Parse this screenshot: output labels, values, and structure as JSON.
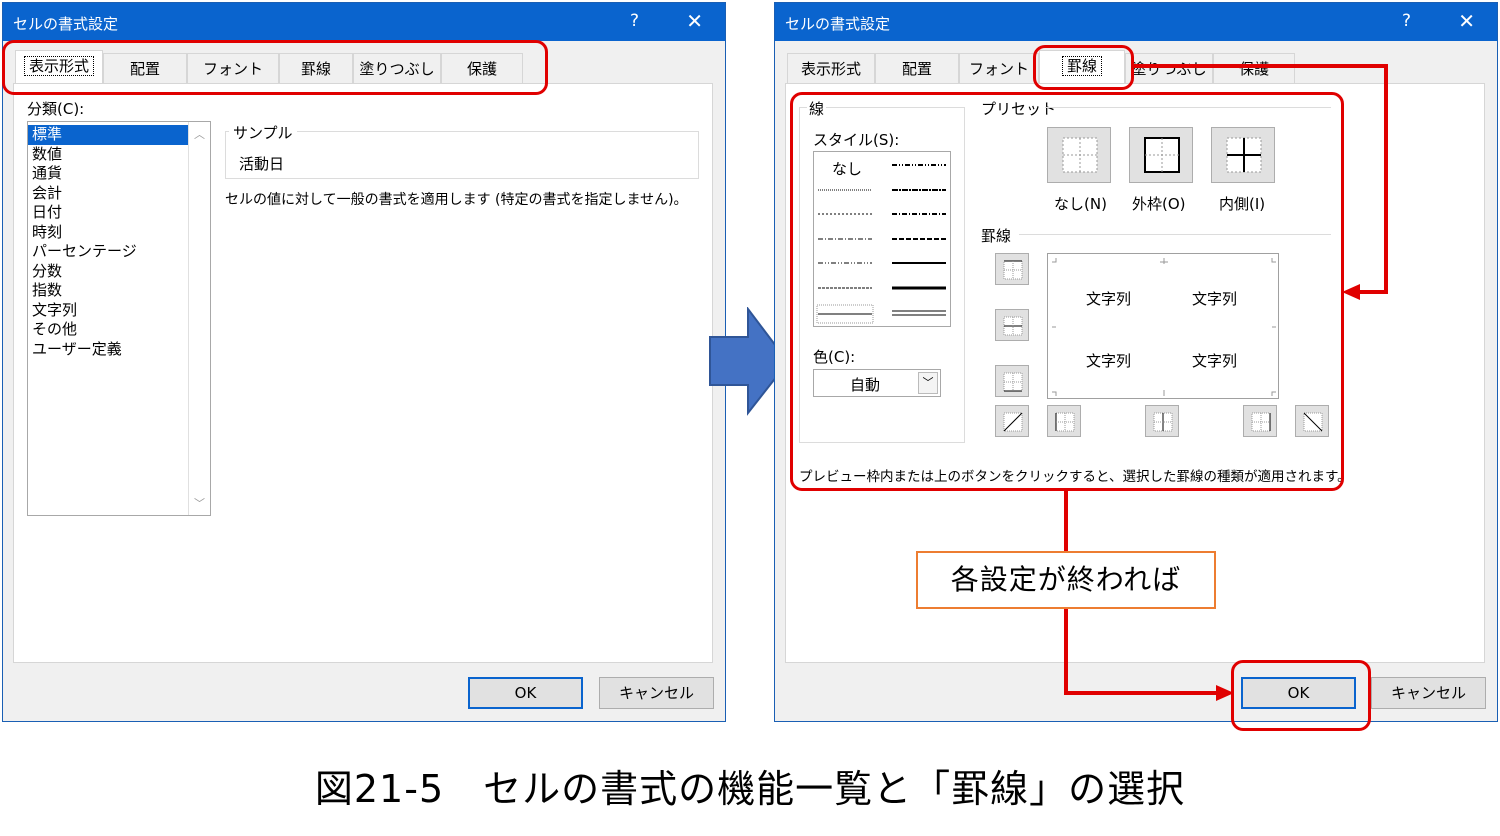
{
  "left_dialog": {
    "title": "セルの書式設定",
    "help_icon": "?",
    "close_icon": "✕",
    "tabs": [
      "表示形式",
      "配置",
      "フォント",
      "罫線",
      "塗りつぶし",
      "保護"
    ],
    "active_tab": "表示形式",
    "category_label": "分類(C):",
    "categories": [
      "標準",
      "数値",
      "通貨",
      "会計",
      "日付",
      "時刻",
      "パーセンテージ",
      "分数",
      "指数",
      "文字列",
      "その他",
      "ユーザー定義"
    ],
    "selected_category": "標準",
    "sample_label": "サンプル",
    "sample_value": "活動日",
    "description": "セルの値に対して一般の書式を適用します (特定の書式を指定しません)。",
    "ok": "OK",
    "cancel": "キャンセル"
  },
  "right_dialog": {
    "title": "セルの書式設定",
    "help_icon": "?",
    "close_icon": "✕",
    "tabs": [
      "表示形式",
      "配置",
      "フォント",
      "罫線",
      "塗りつぶし",
      "保護"
    ],
    "active_tab": "罫線",
    "line_group": "線",
    "style_label": "スタイル(S):",
    "style_none": "なし",
    "color_label": "色(C):",
    "color_value": "自動",
    "preset_group": "プリセット",
    "presets": [
      "なし(N)",
      "外枠(O)",
      "内側(I)"
    ],
    "border_group": "罫線",
    "preview_text": "文字列",
    "hint": "プレビュー枠内または上のボタンをクリックすると、選択した罫線の種類が適用されます。",
    "ok": "OK",
    "cancel": "キャンセル"
  },
  "callout": "各設定が終われば",
  "caption": "図21-5　セルの書式の機能一覧と「罫線」の選択",
  "colors": {
    "titlebar": "#0a64ce",
    "highlight": "#e00000",
    "arrow": "#4472c4",
    "callout_border": "#ed7d31"
  }
}
